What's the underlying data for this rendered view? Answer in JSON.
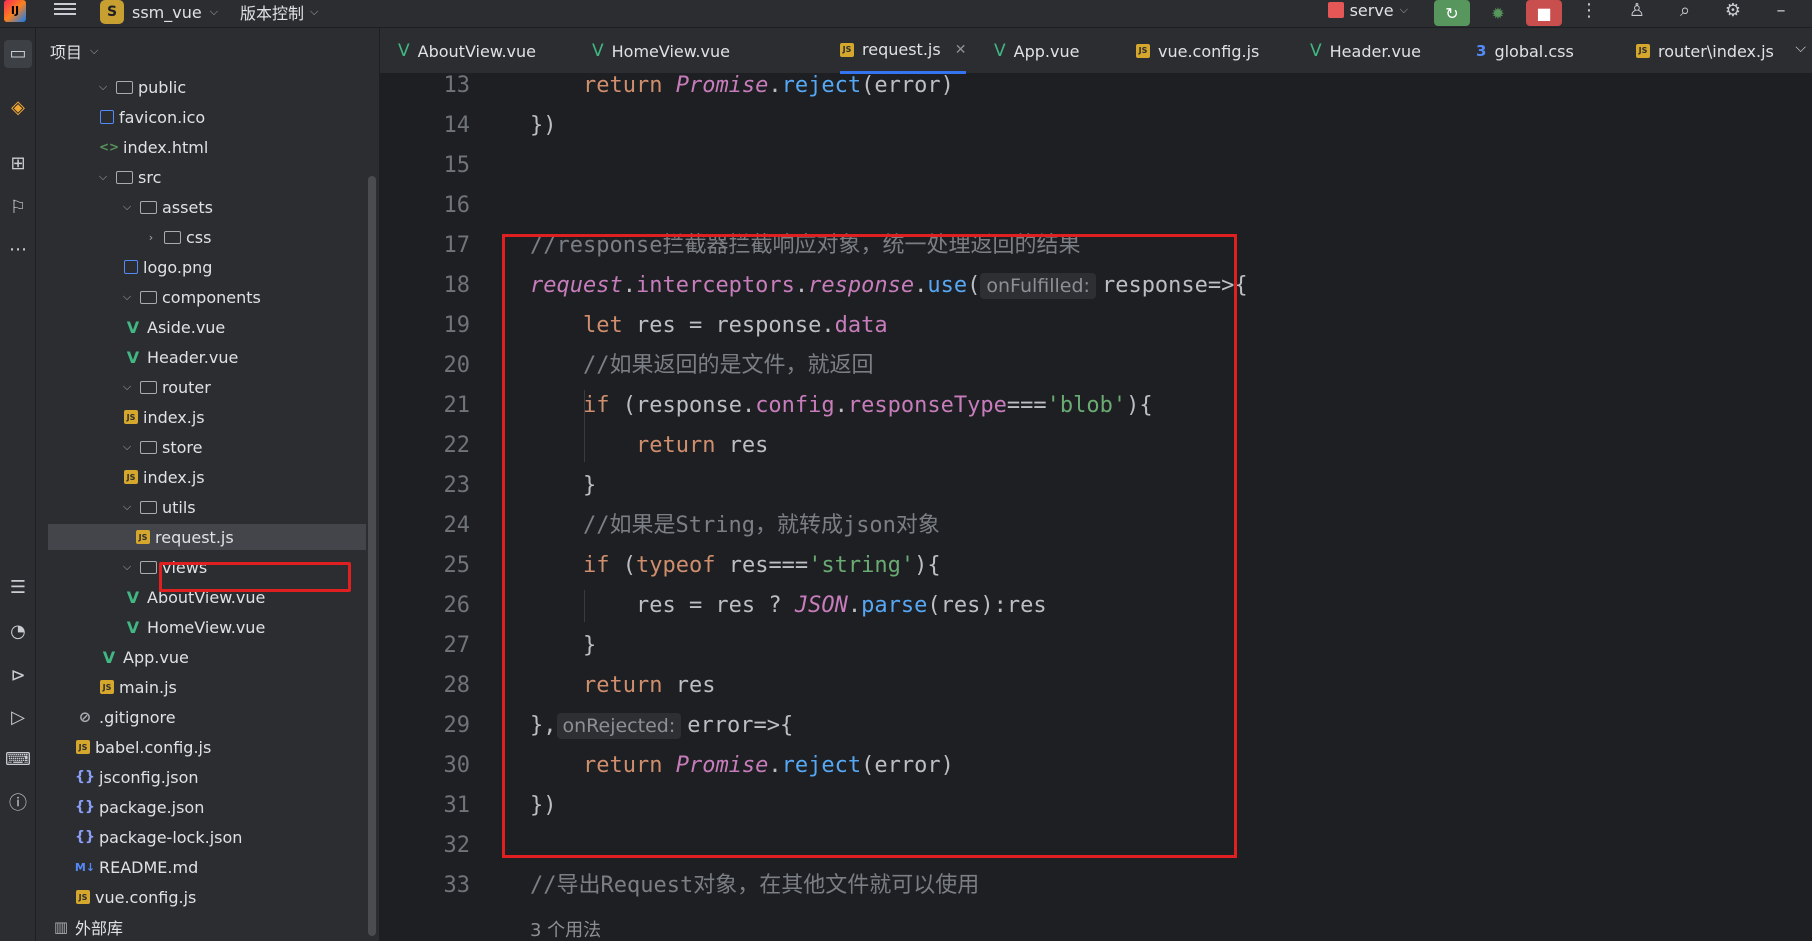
{
  "titlebar": {
    "logo_text": "IJ",
    "project_badge": "S",
    "project_name": "ssm_vue",
    "vcs_label": "版本控制",
    "run_config": "serve"
  },
  "project_panel": {
    "title": "项目",
    "tree": [
      {
        "label": "public",
        "type": "folder",
        "depth": 1,
        "expanded": true
      },
      {
        "label": "favicon.ico",
        "type": "img",
        "depth": 2
      },
      {
        "label": "index.html",
        "type": "html",
        "depth": 2
      },
      {
        "label": "src",
        "type": "folder",
        "depth": 1,
        "expanded": true
      },
      {
        "label": "assets",
        "type": "folder",
        "depth": 2,
        "expanded": true
      },
      {
        "label": "css",
        "type": "folder",
        "depth": 3,
        "expanded": false
      },
      {
        "label": "logo.png",
        "type": "img",
        "depth": 3
      },
      {
        "label": "components",
        "type": "folder",
        "depth": 2,
        "expanded": true
      },
      {
        "label": "Aside.vue",
        "type": "vue",
        "depth": 3
      },
      {
        "label": "Header.vue",
        "type": "vue",
        "depth": 3
      },
      {
        "label": "router",
        "type": "folder",
        "depth": 2,
        "expanded": true
      },
      {
        "label": "index.js",
        "type": "js",
        "depth": 3
      },
      {
        "label": "store",
        "type": "folder",
        "depth": 2,
        "expanded": true
      },
      {
        "label": "index.js",
        "type": "js",
        "depth": 3
      },
      {
        "label": "utils",
        "type": "folder",
        "depth": 2,
        "expanded": true
      },
      {
        "label": "request.js",
        "type": "js",
        "depth": 3,
        "selected": true
      },
      {
        "label": "views",
        "type": "folder",
        "depth": 2,
        "expanded": true
      },
      {
        "label": "AboutView.vue",
        "type": "vue",
        "depth": 3
      },
      {
        "label": "HomeView.vue",
        "type": "vue",
        "depth": 3
      },
      {
        "label": "App.vue",
        "type": "vue",
        "depth": 2
      },
      {
        "label": "main.js",
        "type": "js",
        "depth": 2
      },
      {
        "label": ".gitignore",
        "type": "ignore",
        "depth": 1
      },
      {
        "label": "babel.config.js",
        "type": "js",
        "depth": 1
      },
      {
        "label": "jsconfig.json",
        "type": "json",
        "depth": 1
      },
      {
        "label": "package.json",
        "type": "json",
        "depth": 1
      },
      {
        "label": "package-lock.json",
        "type": "json",
        "depth": 1
      },
      {
        "label": "README.md",
        "type": "md",
        "depth": 1
      },
      {
        "label": "vue.config.js",
        "type": "js",
        "depth": 1
      },
      {
        "label": "外部库",
        "type": "lib",
        "depth": 0
      }
    ]
  },
  "tabs": [
    {
      "label": "AboutView.vue",
      "type": "vue"
    },
    {
      "label": "HomeView.vue",
      "type": "vue"
    },
    {
      "label": "request.js",
      "type": "js",
      "active": true
    },
    {
      "label": "App.vue",
      "type": "vue"
    },
    {
      "label": "vue.config.js",
      "type": "js"
    },
    {
      "label": "Header.vue",
      "type": "vue"
    },
    {
      "label": "global.css",
      "type": "css"
    },
    {
      "label": "router\\index.js",
      "type": "js"
    }
  ],
  "editor": {
    "lines": [
      {
        "n": "13",
        "tokens": [
          [
            "",
            "    "
          ],
          [
            "kw",
            "return "
          ],
          [
            "it",
            "Promise"
          ],
          [
            "",
            "."
          ],
          [
            "fn",
            "reject"
          ],
          [
            "",
            "(error)"
          ]
        ]
      },
      {
        "n": "14",
        "tokens": [
          [
            "",
            "})"
          ]
        ]
      },
      {
        "n": "15",
        "tokens": []
      },
      {
        "n": "16",
        "tokens": []
      },
      {
        "n": "17",
        "tokens": [
          [
            "cmt",
            "//response拦截器拦截响应对象，统一处理返回的结果"
          ]
        ]
      },
      {
        "n": "18",
        "tokens": [
          [
            "it",
            "request"
          ],
          [
            "",
            "."
          ],
          [
            "prop",
            "interceptors"
          ],
          [
            "",
            "."
          ],
          [
            "it",
            "response"
          ],
          [
            "",
            "."
          ],
          [
            "fn",
            "use"
          ],
          [
            "",
            "("
          ],
          [
            "hint",
            "onFulfilled:"
          ],
          [
            "",
            "response=>{"
          ]
        ]
      },
      {
        "n": "19",
        "tokens": [
          [
            "",
            "    "
          ],
          [
            "kw",
            "let "
          ],
          [
            "",
            "res = response."
          ],
          [
            "prop",
            "data"
          ]
        ]
      },
      {
        "n": "20",
        "tokens": [
          [
            "",
            "    "
          ],
          [
            "cmt",
            "//如果返回的是文件，就返回"
          ]
        ]
      },
      {
        "n": "21",
        "tokens": [
          [
            "",
            "    "
          ],
          [
            "kw",
            "if "
          ],
          [
            "",
            "(response."
          ],
          [
            "prop",
            "config"
          ],
          [
            "",
            "."
          ],
          [
            "prop",
            "responseType"
          ],
          [
            "",
            "==="
          ],
          [
            "str",
            "'blob'"
          ],
          [
            "",
            "){"
          ]
        ]
      },
      {
        "n": "22",
        "tokens": [
          [
            "",
            "        "
          ],
          [
            "kw",
            "return "
          ],
          [
            "",
            "res"
          ]
        ]
      },
      {
        "n": "23",
        "tokens": [
          [
            "",
            "    }"
          ]
        ]
      },
      {
        "n": "24",
        "tokens": [
          [
            "",
            "    "
          ],
          [
            "cmt",
            "//如果是String，就转成json对象"
          ]
        ]
      },
      {
        "n": "25",
        "tokens": [
          [
            "",
            "    "
          ],
          [
            "kw",
            "if "
          ],
          [
            "",
            "("
          ],
          [
            "kw",
            "typeof "
          ],
          [
            "",
            "res==="
          ],
          [
            "str",
            "'string'"
          ],
          [
            "",
            "){"
          ]
        ]
      },
      {
        "n": "26",
        "tokens": [
          [
            "",
            "        res = res ? "
          ],
          [
            "it",
            "JSON"
          ],
          [
            "",
            "."
          ],
          [
            "fn",
            "parse"
          ],
          [
            "",
            "(res):res"
          ]
        ]
      },
      {
        "n": "27",
        "tokens": [
          [
            "",
            "    }"
          ]
        ]
      },
      {
        "n": "28",
        "tokens": [
          [
            "",
            "    "
          ],
          [
            "kw",
            "return "
          ],
          [
            "",
            "res"
          ]
        ]
      },
      {
        "n": "29",
        "tokens": [
          [
            "",
            "},"
          ],
          [
            "hint",
            "onRejected:"
          ],
          [
            "",
            "error=>{"
          ]
        ]
      },
      {
        "n": "30",
        "tokens": [
          [
            "",
            "    "
          ],
          [
            "kw",
            "return "
          ],
          [
            "it",
            "Promise"
          ],
          [
            "",
            "."
          ],
          [
            "fn",
            "reject"
          ],
          [
            "",
            "(error)"
          ]
        ]
      },
      {
        "n": "31",
        "tokens": [
          [
            "",
            "})"
          ]
        ]
      },
      {
        "n": "32",
        "tokens": []
      },
      {
        "n": "33",
        "tokens": [
          [
            "cmt",
            "//导出Request对象，在其他文件就可以使用"
          ]
        ]
      }
    ],
    "usage_hint": "3 个用法"
  }
}
